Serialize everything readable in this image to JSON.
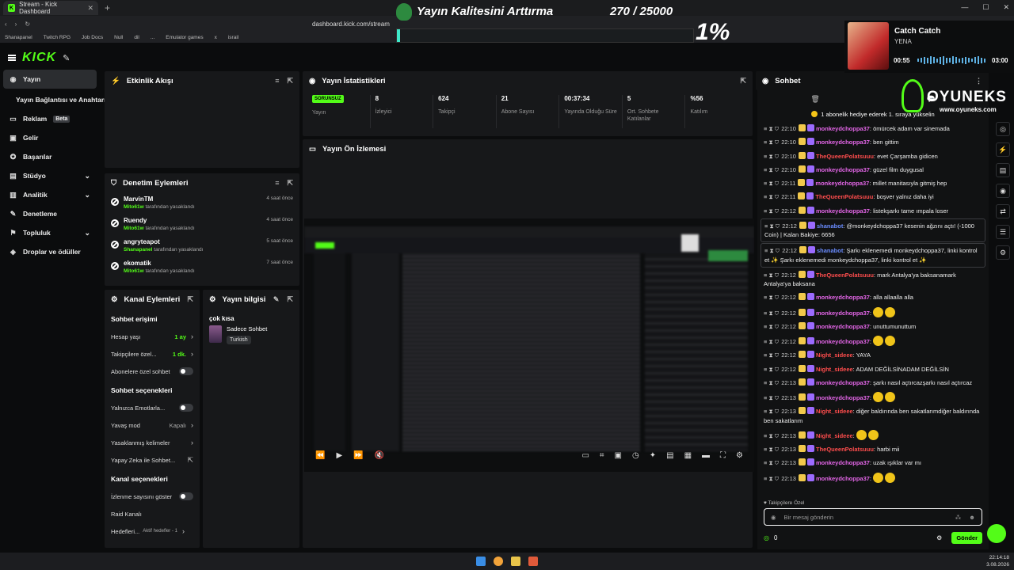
{
  "browser": {
    "tab_title": "Stream - Kick Dashboard",
    "url": "dashboard.kick.com/stream",
    "bookmarks": [
      "Shanapanel",
      "Twitch RPG",
      "Job Docs",
      "Null",
      "dil",
      "...",
      "Emulator games",
      "x",
      "israil"
    ]
  },
  "goal": {
    "title": "Yayın Kalitesini Arttırma",
    "count": "270 / 25000",
    "percent_label": "1%",
    "progress": 0.011
  },
  "music": {
    "title": "Catch Catch",
    "artist": "YENA",
    "time_elapsed": "00:55",
    "time_total": "03:00"
  },
  "watermark": {
    "name": "OYUNEKS",
    "site": "www.oyuneks.com"
  },
  "nav": {
    "items": [
      {
        "icon": "stream-icon",
        "label": "Yayın",
        "active": true
      },
      {
        "label": "Yayın Bağlantısı ve Anahtarı",
        "sub": true
      },
      {
        "icon": "ad-icon",
        "label": "Reklam",
        "badge": "Beta"
      },
      {
        "icon": "income-icon",
        "label": "Gelir"
      },
      {
        "icon": "achievements-icon",
        "label": "Başarılar"
      },
      {
        "icon": "studio-icon",
        "label": "Stüdyo",
        "chevron": true
      },
      {
        "icon": "analytics-icon",
        "label": "Analitik",
        "chevron": true
      },
      {
        "icon": "moderation-icon",
        "label": "Denetleme"
      },
      {
        "icon": "community-icon",
        "label": "Topluluk",
        "chevron": true
      },
      {
        "icon": "drops-icon",
        "label": "Droplar ve ödüller"
      }
    ]
  },
  "activity": {
    "title": "Etkinlik Akışı"
  },
  "stats": {
    "title": "Yayın İstatistikleri",
    "items": [
      {
        "value": "SORUNSUZ",
        "label": "Yayın",
        "badge": true
      },
      {
        "value": "8",
        "label": "İzleyici"
      },
      {
        "value": "624",
        "label": "Takipçi"
      },
      {
        "value": "21",
        "label": "Abone Sayısı"
      },
      {
        "value": "00:37:34",
        "label": "Yayında Olduğu Süre"
      },
      {
        "value": "5",
        "label": "Ort. Sohbete Katılanlar"
      },
      {
        "value": "%56",
        "label": "Katılım"
      }
    ]
  },
  "moderation": {
    "title": "Denetim Eylemleri",
    "rows": [
      {
        "user": "MarvinTM",
        "by": "Mito61w",
        "action": "tarafından yasaklandı",
        "when": "4 saat önce"
      },
      {
        "user": "Ruendy",
        "by": "Mito61w",
        "action": "tarafından yasaklandı",
        "when": "4 saat önce"
      },
      {
        "user": "angryteapot",
        "by": "Shanapanel",
        "action": "tarafından yasaklandı",
        "when": "5 saat önce"
      },
      {
        "user": "ekomatik",
        "by": "Mito61w",
        "action": "tarafından yasaklandı",
        "when": "7 saat önce"
      }
    ]
  },
  "channel_actions": {
    "title": "Kanal Eylemleri",
    "chat_access": "Sohbet erişimi",
    "acc_age": {
      "label": "Hesap yaşı",
      "value": "1 ay"
    },
    "follower_age": {
      "label": "Takipçilere özel...",
      "value": "1 dk."
    },
    "subs_only": "Abonelere özel sohbet",
    "chat_options": "Sohbet seçenekleri",
    "emote_only": "Yalnızca Emotlarla...",
    "slow_mode": {
      "label": "Yavaş mod",
      "value": "Kapalı"
    },
    "banned_words": "Yasaklanmış kelimeler",
    "ai_chat": "Yapay Zeka ile Sohbet...",
    "channel_options": "Kanal seçenekleri",
    "show_viewers": "İzlenme sayısını göster",
    "raid": "Raid Kanalı",
    "goals": {
      "label": "Hedefleri...",
      "value": "Aktif hedefler - 1"
    }
  },
  "stream_info": {
    "title": "Yayın bilgisi",
    "stream_title": "çok kısa",
    "category": "Sadece Sohbet",
    "language": "Turkish"
  },
  "preview": {
    "title": "Yayın Ön İzlemesi"
  },
  "chat": {
    "title": "Sohbet",
    "gift_note": "1 abonelik hediye ederek 1. sıraya yükselin",
    "followers_only": "Takipçilere Özel",
    "placeholder": "Bir mesaj gönderin",
    "points": "0",
    "send": "Gönder",
    "colors": {
      "pink": "#e466e8",
      "purple": "#9b6bff",
      "red": "#ff4d4d",
      "blue": "#6a8cff"
    },
    "messages": [
      {
        "time": "22:10",
        "user": "monkeydchoppa37",
        "color": "pink",
        "text": "ömürcek adam var sinemada"
      },
      {
        "time": "22:10",
        "user": "monkeydchoppa37",
        "color": "pink",
        "text": "ben gittim"
      },
      {
        "time": "22:10",
        "user": "TheQueenPolatsuuu",
        "color": "red",
        "text": "evet Çarşamba gidicen"
      },
      {
        "time": "22:10",
        "user": "monkeydchoppa37",
        "color": "pink",
        "text": "güzel film duygusal"
      },
      {
        "time": "22:11",
        "user": "monkeydchoppa37",
        "color": "pink",
        "text": "millet manitasıyla gitmiş hep"
      },
      {
        "time": "22:11",
        "user": "TheQueenPolatsuuu",
        "color": "red",
        "text": "boşver yalnız daha iyi"
      },
      {
        "time": "22:12",
        "user": "monkeydchoppa37",
        "color": "pink",
        "text": "listekşarkı tame ımpala loser"
      },
      {
        "time": "22:12",
        "user": "shanabot",
        "color": "blue",
        "text": "@monkeydchoppa37 kesenin ağzını açtı! (-1000 Coin) | Kalan Bakiye: 6656",
        "hl": true
      },
      {
        "time": "22:12",
        "user": "shanabot",
        "color": "blue",
        "text": "Şarkı eklenemedi monkeydchoppa37, linki kontrol et ✨ Şarkı eklenemedi monkeydchoppa37, linki kontrol et ✨",
        "hl": true
      },
      {
        "time": "22:12",
        "user": "TheQueenPolatsuuu",
        "color": "red",
        "text": "mark Antalya'ya baksanamark Antalya'ya baksana"
      },
      {
        "time": "22:12",
        "user": "monkeydchoppa37",
        "color": "pink",
        "text": "alla allaalla alla"
      },
      {
        "time": "22:12",
        "user": "monkeydchoppa37",
        "color": "pink",
        "text": ""
      },
      {
        "time": "22:12",
        "user": "monkeydchoppa37",
        "color": "pink",
        "text": "unuttumunuttum"
      },
      {
        "time": "22:12",
        "user": "monkeydchoppa37",
        "color": "pink",
        "text": ""
      },
      {
        "time": "22:12",
        "user": "Night_sideee",
        "color": "red",
        "text": "YAYA"
      },
      {
        "time": "22:12",
        "user": "Night_sideee",
        "color": "red",
        "text": "ADAM DEĞİLSİNADAM DEĞİLSİN"
      },
      {
        "time": "22:13",
        "user": "monkeydchoppa37",
        "color": "pink",
        "text": "şarkı nasıl açtırcazşarkı nasıl açtırcaz"
      },
      {
        "time": "22:13",
        "user": "monkeydchoppa37",
        "color": "pink",
        "text": ""
      },
      {
        "time": "22:13",
        "user": "Night_sideee",
        "color": "red",
        "text": "diğer baldırında ben sakatlarımdiğer baldırında ben sakatlarım"
      },
      {
        "time": "22:13",
        "user": "Night_sideee",
        "color": "red",
        "text": ""
      },
      {
        "time": "22:13",
        "user": "TheQueenPolatsuuu",
        "color": "red",
        "text": "harbi mii"
      },
      {
        "time": "22:13",
        "user": "monkeydchoppa37",
        "color": "pink",
        "text": "uzak ışıklar var mı"
      },
      {
        "time": "22:13",
        "user": "monkeydchoppa37",
        "color": "pink",
        "text": ""
      }
    ]
  },
  "taskbar": {
    "time": "22:14:18",
    "date": "3.08.2026"
  }
}
